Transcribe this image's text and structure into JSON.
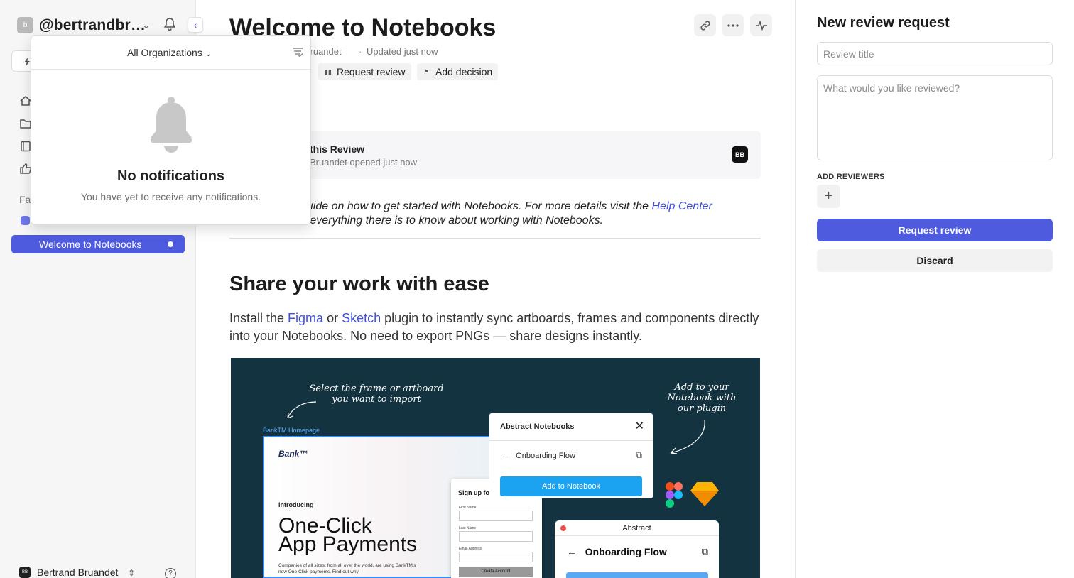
{
  "sidebar": {
    "workspace_avatar": "b",
    "workspace_name": "@bertrandbr…",
    "favorites_label": "Fa",
    "active_item": "Welcome to Notebooks",
    "user_avatar": "BB",
    "user_name": "Bertrand Bruandet",
    "icons": [
      "chevron-down-icon",
      "bell-icon",
      "chevron-left-icon",
      "bolt-icon",
      "home-icon",
      "folder-icon",
      "notebook-icon",
      "thumbs-up-icon",
      "help-icon"
    ]
  },
  "notifications": {
    "org_select": "All Organizations",
    "title": "No notifications",
    "subtitle": "You have yet to receive any notifications."
  },
  "main": {
    "title": "Welcome to Notebooks",
    "meta_author": "d Bruandet",
    "meta_updated": "Updated just now",
    "chips": {
      "request_review": "Request review",
      "add_decision": "Add decision"
    },
    "review_card": {
      "title": "this Review",
      "subtitle": "Bruandet opened just now",
      "avatar": "BB"
    },
    "intro": {
      "line1_pre": "guide on how to get started with Notebooks. For more details visit the ",
      "line1_link": "Help Center",
      "line2": "d everything there is to know about working with Notebooks."
    },
    "section_title": "Share your work with ease",
    "para": {
      "pre": "Install the ",
      "figma": "Figma",
      "mid": " or ",
      "sketch": "Sketch",
      "post": " plugin to instantly sync artboards, frames and components directly into your Notebooks. No need to export PNGs — share designs instantly."
    }
  },
  "hero": {
    "note_left": "Select the frame or artboard\nyou want to import",
    "note_right": "Add to your\nNotebook with\nour plugin",
    "bank_label": "BankTM Homepage",
    "bank_logo": "Bank™",
    "bank_intro": "Introducing",
    "bank_big": "One-Click\nApp Payments",
    "bank_small": "Companies of all sizes, from all over the world, are using BankTM's new One-Click payments. Find out why",
    "signup_title": "Sign up fo",
    "signup_first": "First Name",
    "signup_last": "Last Name",
    "signup_email": "Email Address",
    "signup_btn": "Create Account",
    "plugin_title": "Abstract Notebooks",
    "plugin_flow": "Onboarding Flow",
    "plugin_btn": "Add to Notebook",
    "abstract_title": "Abstract",
    "abstract_flow": "Onboarding Flow"
  },
  "rpanel": {
    "title": "New review request",
    "title_placeholder": "Review title",
    "body_placeholder": "What would you like reviewed?",
    "reviewers_label": "ADD REVIEWERS",
    "add_symbol": "+",
    "primary": "Request review",
    "secondary": "Discard"
  },
  "colors": {
    "accent": "#4f5bdf",
    "link": "#3f4fe0",
    "hero_bg": "#133340",
    "plugin_btn": "#1ba2f0"
  }
}
